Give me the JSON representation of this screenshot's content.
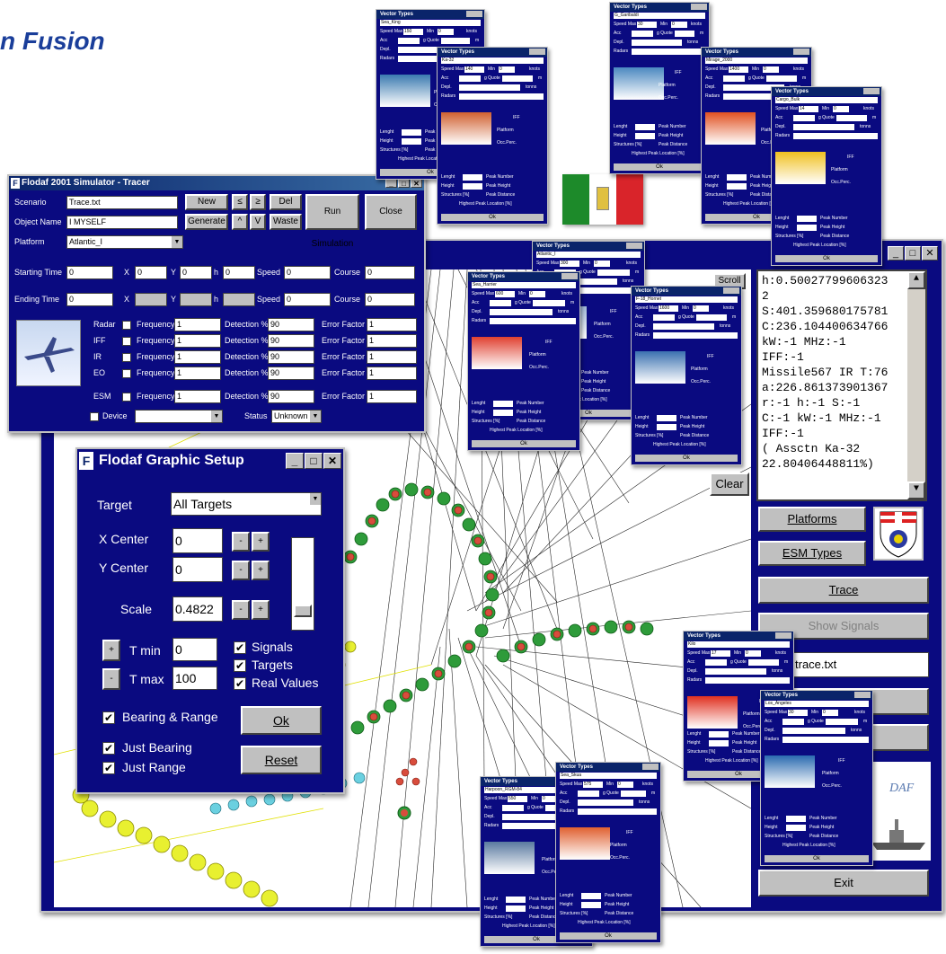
{
  "heading": "n Fusion",
  "tracer": {
    "title": "Flodaf 2001 Simulator - Tracer",
    "scenario_label": "Scenario",
    "scenario_value": "Trace.txt",
    "object_label": "Object Name",
    "object_value": "I MYSELF",
    "platform_label": "Platform",
    "platform_value": "Atlantic_I",
    "new_label": "New",
    "le_label": "≤",
    "ge_label": "≥",
    "del_label": "Del",
    "generate_label": "Generate",
    "up_label": "^",
    "v_label": "V",
    "waste_label": "Waste",
    "run_label": "Run Simulation",
    "close_label": "Close",
    "start_label": "Starting Time",
    "end_label": "Ending Time",
    "start_value": "0",
    "end_value": "0",
    "x_label": "X",
    "y_label": "Y",
    "h_label": "h",
    "speed_label": "Speed",
    "course_label": "Course",
    "zero": "0",
    "sensors": [
      {
        "name": "Radar",
        "freq": "1",
        "det": "90",
        "err": "1"
      },
      {
        "name": "IFF",
        "freq": "1",
        "det": "90",
        "err": "1"
      },
      {
        "name": "IR",
        "freq": "1",
        "det": "90",
        "err": "1"
      },
      {
        "name": "EO",
        "freq": "1",
        "det": "90",
        "err": "1"
      },
      {
        "name": "ESM",
        "freq": "1",
        "det": "90",
        "err": "1"
      }
    ],
    "frequency_label": "Frequency",
    "detection_label": "Detection %",
    "error_label": "Error Factor",
    "device_label": "Device",
    "status_label": "Status",
    "status_value": "Unknown"
  },
  "graphic": {
    "title": "Flodaf Graphic Setup",
    "target_label": "Target",
    "target_value": "All Targets",
    "xcenter_label": "X Center",
    "xcenter_value": "0",
    "ycenter_label": "Y Center",
    "ycenter_value": "0",
    "scale_label": "Scale",
    "scale_value": "0.4822",
    "tmin_label": "T min",
    "tmin_value": "0",
    "tmax_label": "T max",
    "tmax_value": "100",
    "plus": "+",
    "minus": "-",
    "signals": "Signals",
    "targets": "Targets",
    "real_values": "Real Values",
    "bearing_range": "Bearing & Range",
    "just_bearing": "Just Bearing",
    "just_range": "Just Range",
    "ok": "Ok",
    "reset": "Reset"
  },
  "main": {
    "clear": "Clear",
    "platforms": "Platforms",
    "esm_types": "ESM Types",
    "trace": "Trace",
    "show_signals": "Show Signals",
    "file": "trace.txt",
    "exit": "Exit",
    "scroll": "Scroll",
    "flodaf_logo": "DAF",
    "log_lines": [
      "h:0.50027799606323",
      "2",
      "S:401.359680175781",
      "C:236.104400634766",
      "kW:-1 MHz:-1",
      "IFF:-1",
      "Missile567 IR T:76",
      "a:226.861373901367",
      "r:-1 h:-1 S:-1",
      "C:-1 kW:-1 MHz:-1",
      "IFF:-1",
      "( Assctn Ka-32",
      "22.80406448811%)"
    ]
  },
  "vector": {
    "title": "Vector Types",
    "speed_max": "Speed Max",
    "min": "Min",
    "knots": "knots",
    "acc": "Acc",
    "g": "g",
    "quote": "Quote",
    "m": "m",
    "depl": "Depl.",
    "tonns": "tonns",
    "radars": "Radars",
    "iff": "IFF",
    "platform": "Platform",
    "occ_perc": "Occ.Perc.",
    "lenght": "Lenght",
    "height": "Height",
    "structures": "Structures [%]",
    "peak_number": "Peak Number",
    "peak_height": "Peak Height",
    "peak_distance": "Peak Distance",
    "highest_peak": "Highest Peak Location [%]",
    "ok": "Ok",
    "windows": [
      {
        "name": "Sea_King",
        "speed": "150",
        "min": "0"
      },
      {
        "name": "Ka-32",
        "speed": "140",
        "min": "0"
      },
      {
        "name": "G_Garibaldi",
        "speed": "30",
        "min": "0"
      },
      {
        "name": "Mirage_2000",
        "speed": "1400",
        "min": "0"
      },
      {
        "name": "Cargo_Bulk",
        "speed": "14",
        "min": "0"
      },
      {
        "name": "Atlantic_I",
        "speed": "300",
        "min": "0"
      },
      {
        "name": "Sea_Harrier",
        "speed": "600",
        "min": "0"
      },
      {
        "name": "F-18_Hornet",
        "speed": "1600",
        "min": "0"
      },
      {
        "name": "Kilo",
        "speed": "17",
        "min": "0"
      },
      {
        "name": "Los_Angeles",
        "speed": "30",
        "min": "0"
      },
      {
        "name": "Harpoon_RGM-84",
        "speed": "550",
        "min": "0"
      },
      {
        "name": "Sea_Skua",
        "speed": "575",
        "min": "0"
      }
    ]
  },
  "colors": {
    "window_bg": "#0a0a80",
    "titlebar": "#0a246a",
    "button": "#c0c0c0",
    "track_red": "#d84c3c",
    "track_green": "#1f8f2a",
    "track_yellow": "#f0f020"
  }
}
